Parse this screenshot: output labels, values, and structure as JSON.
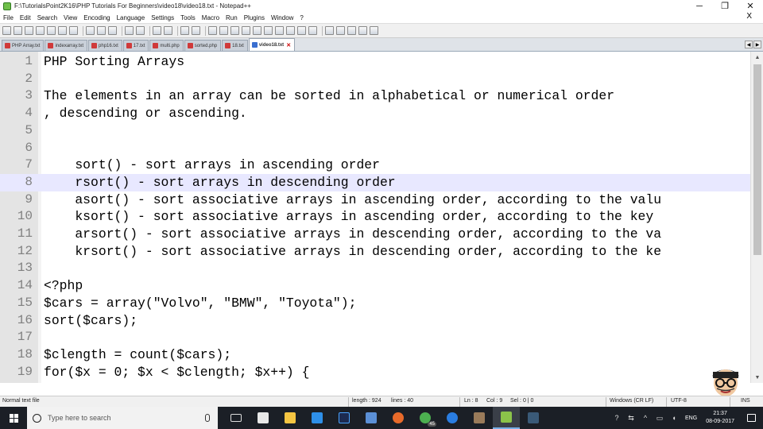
{
  "window": {
    "title": "F:\\TutorialsPoint2K16\\PHP Tutorials For Beginners\\video18\\video18.txt - Notepad++",
    "minimize": "─",
    "maximize": "❐",
    "close": "✕"
  },
  "menu": {
    "items": [
      "File",
      "Edit",
      "Search",
      "View",
      "Encoding",
      "Language",
      "Settings",
      "Tools",
      "Macro",
      "Run",
      "Plugins",
      "Window",
      "?"
    ],
    "close_glyph": "X"
  },
  "tabs": [
    {
      "label": "PHP Array.txt",
      "active": false
    },
    {
      "label": "indexarray.txt",
      "active": false
    },
    {
      "label": "php16.txt",
      "active": false
    },
    {
      "label": "17.txt",
      "active": false
    },
    {
      "label": "multi.php",
      "active": false
    },
    {
      "label": "sorted.php",
      "active": false
    },
    {
      "label": "18.txt",
      "active": false
    },
    {
      "label": "video18.txt",
      "active": true
    }
  ],
  "editor": {
    "current_line": 8,
    "lines": [
      {
        "n": "1",
        "text": "PHP Sorting Arrays"
      },
      {
        "n": "2",
        "text": ""
      },
      {
        "n": "3",
        "text": "The elements in an array can be sorted in alphabetical or numerical order"
      },
      {
        "n": "4",
        "text": ", descending or ascending."
      },
      {
        "n": "5",
        "text": ""
      },
      {
        "n": "6",
        "text": ""
      },
      {
        "n": "7",
        "text": "    sort() - sort arrays in ascending order"
      },
      {
        "n": "8",
        "text": "    rsort() - sort arrays in descending order"
      },
      {
        "n": "9",
        "text": "    asort() - sort associative arrays in ascending order, according to the valu"
      },
      {
        "n": "10",
        "text": "    ksort() - sort associative arrays in ascending order, according to the key"
      },
      {
        "n": "11",
        "text": "    arsort() - sort associative arrays in descending order, according to the va"
      },
      {
        "n": "12",
        "text": "    krsort() - sort associative arrays in descending order, according to the ke"
      },
      {
        "n": "13",
        "text": ""
      },
      {
        "n": "14",
        "text": "<?php"
      },
      {
        "n": "15",
        "text": "$cars = array(\"Volvo\", \"BMW\", \"Toyota\");"
      },
      {
        "n": "16",
        "text": "sort($cars);"
      },
      {
        "n": "17",
        "text": ""
      },
      {
        "n": "18",
        "text": "$clength = count($cars);"
      },
      {
        "n": "19",
        "text": "for($x = 0; $x < $clength; $x++) {"
      }
    ]
  },
  "status": {
    "file_type": "Normal text file",
    "length": "length : 924",
    "lines": "lines : 40",
    "ln": "Ln : 8",
    "col": "Col : 9",
    "sel": "Sel : 0 | 0",
    "eol": "Windows (CR LF)",
    "encoding": "UTF-8",
    "mode": "INS"
  },
  "taskbar": {
    "search_placeholder": "Type here to search",
    "language": "ENG",
    "time": "21:37",
    "date": "08-09-2017",
    "badge_count": "45"
  },
  "colors": {
    "current_line": "#e8e8ff",
    "gutter": "#e4e4e4",
    "taskbar": "#1b1f26"
  }
}
